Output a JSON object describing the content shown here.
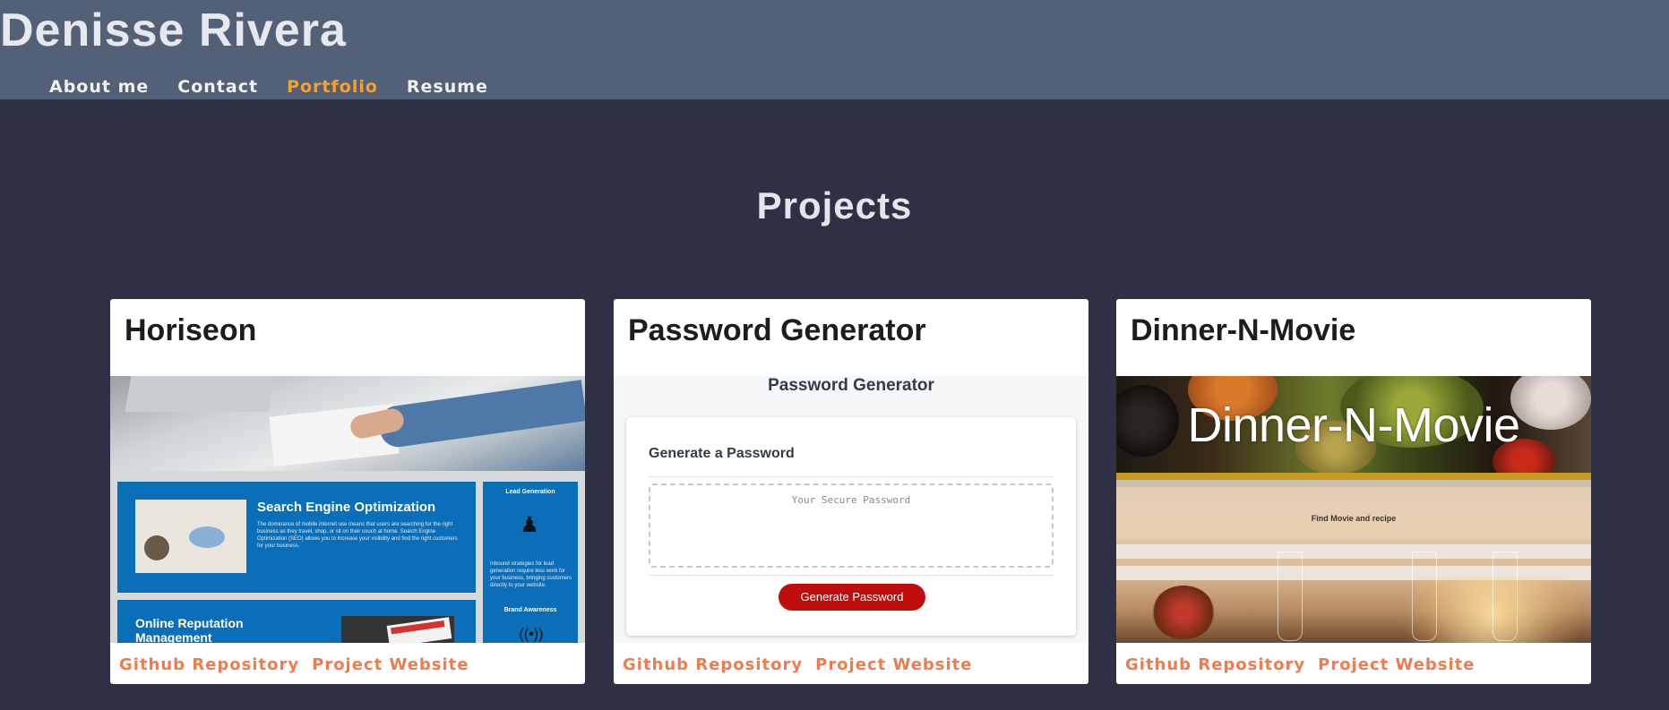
{
  "header": {
    "site_title": "Denisse Rivera",
    "nav": [
      {
        "label": "About me",
        "active": false
      },
      {
        "label": "Contact",
        "active": false
      },
      {
        "label": "Portfolio",
        "active": true
      },
      {
        "label": "Resume",
        "active": false
      }
    ],
    "accent_color": "#f5a12d",
    "background_color": "#526078"
  },
  "main": {
    "heading": "Projects",
    "background_color": "#2e3146"
  },
  "projects": [
    {
      "title": "Horiseon",
      "links": [
        "Github Repository",
        "Project Website"
      ],
      "screenshot": {
        "seo_title": "Search Engine Optimization",
        "seo_text": "The dominance of mobile internet use means that users are searching for the right business as they travel, shop, or sit on their couch at home. Search Engine Optimization (SEO) allows you to increase your visibility and find the right customers for your business.",
        "lead_title": "Lead Generation",
        "lead_text": "Inbound strategies for lead generation require less work for your business, bringing customers directly to your website.",
        "brand_title": "Brand Awareness",
        "orm_title": "Online Reputation Management"
      }
    },
    {
      "title": "Password Generator",
      "links": [
        "Github Repository",
        "Project Website"
      ],
      "screenshot": {
        "app_header": "Password Generator",
        "card_title": "Generate a Password",
        "placeholder": "Your Secure Password",
        "button_label": "Generate Password"
      }
    },
    {
      "title": "Dinner-N-Movie",
      "links": [
        "Github Repository",
        "Project Website"
      ],
      "screenshot": {
        "banner_title": "Dinner-N-Movie",
        "find_label": "Find Movie and recipe"
      }
    }
  ],
  "link_color": "#ee7c4f"
}
